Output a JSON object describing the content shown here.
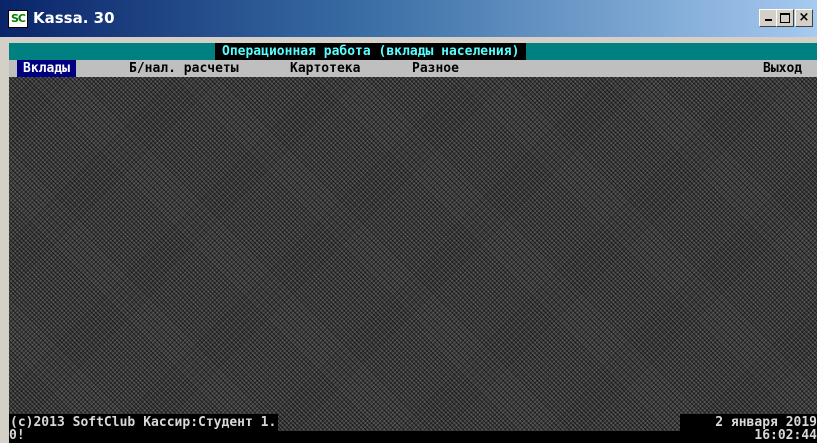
{
  "window": {
    "title": "Kassa. 30",
    "icon": "sc-app-icon",
    "icon_text": "SC",
    "controls": {
      "minimize": "minimize-icon",
      "maximize": "maximize-icon",
      "close": "×"
    }
  },
  "header": {
    "title": "Операционная работа (вклады населения)"
  },
  "menu": {
    "items": [
      {
        "label": "Вклады",
        "active": true
      },
      {
        "label": "Б/нал. расчеты",
        "active": false
      },
      {
        "label": "Картотека",
        "active": false
      },
      {
        "label": "Разное",
        "active": false
      },
      {
        "label": "Выход",
        "active": false
      }
    ]
  },
  "status": {
    "copyright": "(c)2013 SoftClub",
    "cashier": "Кассир:Студент 1.",
    "date": "2 января 2019",
    "time": "16:02:44",
    "prompt": "0!"
  },
  "colors": {
    "header_bg": "#008080",
    "header_text": "#55ffff",
    "menu_bg": "#bfbfbf",
    "menu_active_bg": "#000080",
    "console_text": "#d8d8d8"
  }
}
